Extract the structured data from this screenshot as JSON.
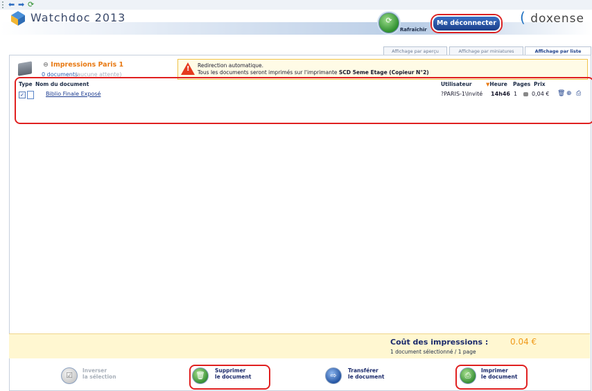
{
  "toolbar": {
    "back_icon": "back-arrow-icon",
    "forward_icon": "forward-arrow-icon",
    "refresh_icon": "refresh-icon"
  },
  "header": {
    "app_title": "Watchdoc 2013",
    "brand": "doxense",
    "refresh_label": "Rafraîchir",
    "logout_label": "Me déconnecter"
  },
  "tabs": [
    {
      "label": "Affichage par aperçu",
      "active": false
    },
    {
      "label": "Affichage par miniatures",
      "active": false
    },
    {
      "label": "Affichage par liste",
      "active": true
    }
  ],
  "queue": {
    "title": "Impressions Paris 1",
    "count": "0 documents",
    "waiting": "(aucune attente)"
  },
  "alert": {
    "line1": "Redirection automatique.",
    "line2_prefix": "Tous les documents seront imprimés sur l'imprimante ",
    "line2_printer": "SCD 5eme Etage (Copieur N°2)"
  },
  "table": {
    "headers": {
      "type": "Type",
      "name": "Nom du document",
      "user": "Utilisateur",
      "heure": "Heure",
      "pages": "Pages",
      "prix": "Prix"
    },
    "rows": [
      {
        "checked": true,
        "name": "Biblio Finale Exposé",
        "user": "?PARIS-1\\Invité",
        "time": "14h46",
        "pages": "1",
        "price": "0,04 €"
      }
    ]
  },
  "cost": {
    "label": "Coût des impressions :",
    "value": "0.04 €",
    "summary": "1 document sélectionné / 1 page"
  },
  "actions": {
    "invert": {
      "line1": "Inverser",
      "line2": "la sélection",
      "enabled": false
    },
    "delete": {
      "line1": "Supprimer",
      "line2": "le document"
    },
    "transfer": {
      "line1": "Transférer",
      "line2": "le document"
    },
    "print": {
      "line1": "Imprimer",
      "line2": "le document"
    }
  },
  "colors": {
    "accent_orange": "#e87a14",
    "highlight_red": "#e02020",
    "link_blue": "#1a3a8f"
  }
}
